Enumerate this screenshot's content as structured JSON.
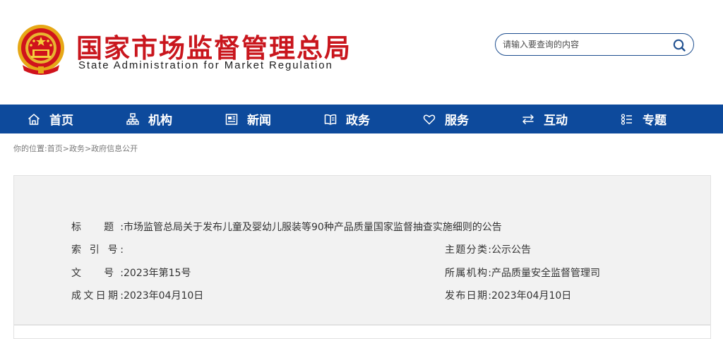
{
  "header": {
    "title_cn": "国家市场监督管理总局",
    "title_en": "State Administration for Market Regulation",
    "emblem": "national-emblem",
    "search": {
      "placeholder": "请输入要查询的内容",
      "icon": "search-icon"
    }
  },
  "nav": {
    "items": [
      {
        "label": "首页",
        "icon": "home-icon"
      },
      {
        "label": "机构",
        "icon": "org-chart-icon"
      },
      {
        "label": "新闻",
        "icon": "newspaper-icon"
      },
      {
        "label": "政务",
        "icon": "book-icon"
      },
      {
        "label": "服务",
        "icon": "heart-icon"
      },
      {
        "label": "互动",
        "icon": "exchange-icon"
      },
      {
        "label": "专题",
        "icon": "list-icon"
      }
    ]
  },
  "breadcrumb": {
    "prefix": "你的位置:",
    "items": [
      "首页",
      "政务",
      "政府信息公开"
    ],
    "separator": ">"
  },
  "info": {
    "title": {
      "label": "标　题:",
      "value": "市场监管总局关于发布儿童及婴幼儿服装等90种产品质量国家监督抽查实施细则的公告"
    },
    "index_no": {
      "label": "索 引 号:",
      "value": ""
    },
    "topic": {
      "label": "主题分类:",
      "value": "公示公告"
    },
    "doc_no": {
      "label": "文　号:",
      "value": "2023年第15号"
    },
    "agency": {
      "label": "所属机构:",
      "value": "产品质量安全监督管理司"
    },
    "written_date": {
      "label": "成文日期:",
      "value": "2023年04月10日"
    },
    "publish_date": {
      "label": "发布日期:",
      "value": "2023年04月10日"
    }
  },
  "colors": {
    "brand_red": "#c9161d",
    "nav_blue": "#0d4a9c",
    "search_border": "#1d4e8f",
    "info_bg": "#f2f2f2"
  }
}
